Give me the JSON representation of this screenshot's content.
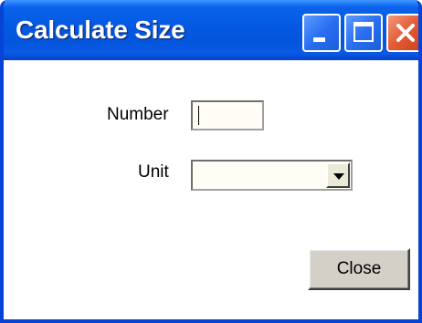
{
  "window": {
    "title": "Calculate Size",
    "minimize_icon": "minimize-icon",
    "maximize_icon": "maximize-icon",
    "close_icon": "close-icon"
  },
  "form": {
    "number_label": "Number",
    "number_value": "",
    "unit_label": "Unit",
    "unit_value": "",
    "dropdown_icon": "chevron-down-icon"
  },
  "footer": {
    "close_label": "Close"
  },
  "colors": {
    "titlebar": "#0458e0",
    "close_button_red": "#e45a34",
    "dialog_background": "#ffffff"
  }
}
